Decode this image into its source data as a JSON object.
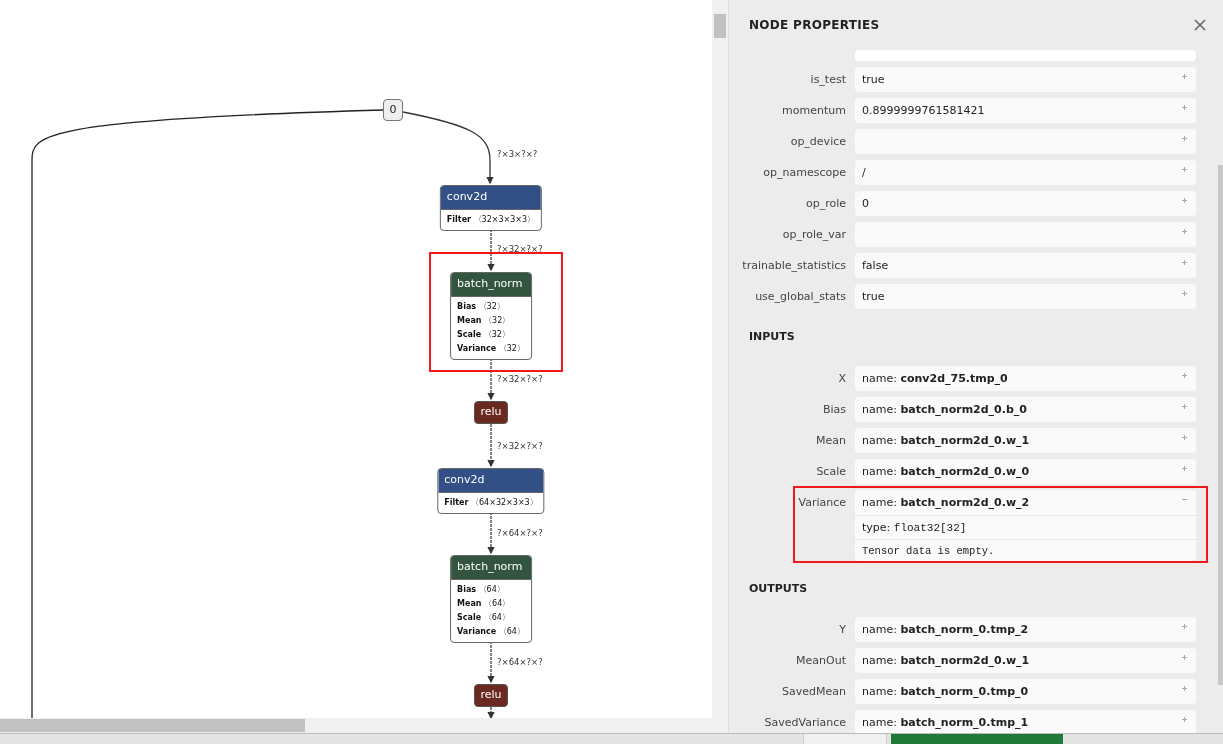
{
  "graph": {
    "nodes": [
      {
        "kind": "input",
        "label": "0"
      },
      {
        "kind": "conv",
        "title": "conv2d",
        "attributes": [
          {
            "name": "Filter",
            "value": "〈32×3×3×3〉"
          }
        ]
      },
      {
        "kind": "norm",
        "title": "batch_norm",
        "attributes": [
          {
            "name": "Bias",
            "value": "〈32〉"
          },
          {
            "name": "Mean",
            "value": "〈32〉"
          },
          {
            "name": "Scale",
            "value": "〈32〉"
          },
          {
            "name": "Variance",
            "value": "〈32〉"
          }
        ]
      },
      {
        "kind": "activation",
        "title": "relu"
      },
      {
        "kind": "conv",
        "title": "conv2d",
        "attributes": [
          {
            "name": "Filter",
            "value": "〈64×32×3×3〉"
          }
        ]
      },
      {
        "kind": "norm",
        "title": "batch_norm",
        "attributes": [
          {
            "name": "Bias",
            "value": "〈64〉"
          },
          {
            "name": "Mean",
            "value": "〈64〉"
          },
          {
            "name": "Scale",
            "value": "〈64〉"
          },
          {
            "name": "Variance",
            "value": "〈64〉"
          }
        ]
      },
      {
        "kind": "activation",
        "title": "relu"
      }
    ],
    "edge_labels": [
      "?×3×?×?",
      "?×32×?×?",
      "?×32×?×?",
      "?×32×?×?",
      "?×64×?×?",
      "?×64×?×?"
    ]
  },
  "panel": {
    "title": "NODE PROPERTIES",
    "attributes": [
      {
        "name": "is_test",
        "value": "true",
        "expanded": false
      },
      {
        "name": "momentum",
        "value": "0.8999999761581421",
        "expanded": false
      },
      {
        "name": "op_device",
        "expanded": false
      },
      {
        "name": "op_namescope",
        "value": "/",
        "expanded": false
      },
      {
        "name": "op_role",
        "value": "0",
        "expanded": false
      },
      {
        "name": "op_role_var",
        "expanded": false
      },
      {
        "name": "trainable_statistics",
        "value": "false",
        "expanded": false
      },
      {
        "name": "use_global_stats",
        "value": "true",
        "expanded": false
      }
    ],
    "sections": [
      {
        "title": "INPUTS",
        "items": [
          {
            "name": "X",
            "value": "name: **conv2d_75.tmp_0**",
            "expanded": false
          },
          {
            "name": "Bias",
            "value": "name: **batch_norm2d_0.b_0**",
            "expanded": false
          },
          {
            "name": "Mean",
            "value": "name: **batch_norm2d_0.w_1**",
            "expanded": false
          },
          {
            "name": "Scale",
            "value": "name: **batch_norm2d_0.w_0**",
            "expanded": false
          },
          {
            "name": "Variance",
            "value": "name: **batch_norm2d_0.w_2**",
            "expanded": true,
            "type_label": "type:",
            "type": "float32[32]",
            "note": "Tensor data is empty."
          }
        ]
      },
      {
        "title": "OUTPUTS",
        "items": [
          {
            "name": "Y",
            "value": "name: **batch_norm_0.tmp_2**",
            "expanded": false
          },
          {
            "name": "MeanOut",
            "value": "name: **batch_norm2d_0.w_1**",
            "expanded": false
          },
          {
            "name": "SavedMean",
            "value": "name: **batch_norm_0.tmp_0**",
            "expanded": false
          },
          {
            "name": "SavedVariance",
            "value": "name: **batch_norm_0.tmp_1**",
            "expanded": false
          }
        ]
      }
    ]
  }
}
